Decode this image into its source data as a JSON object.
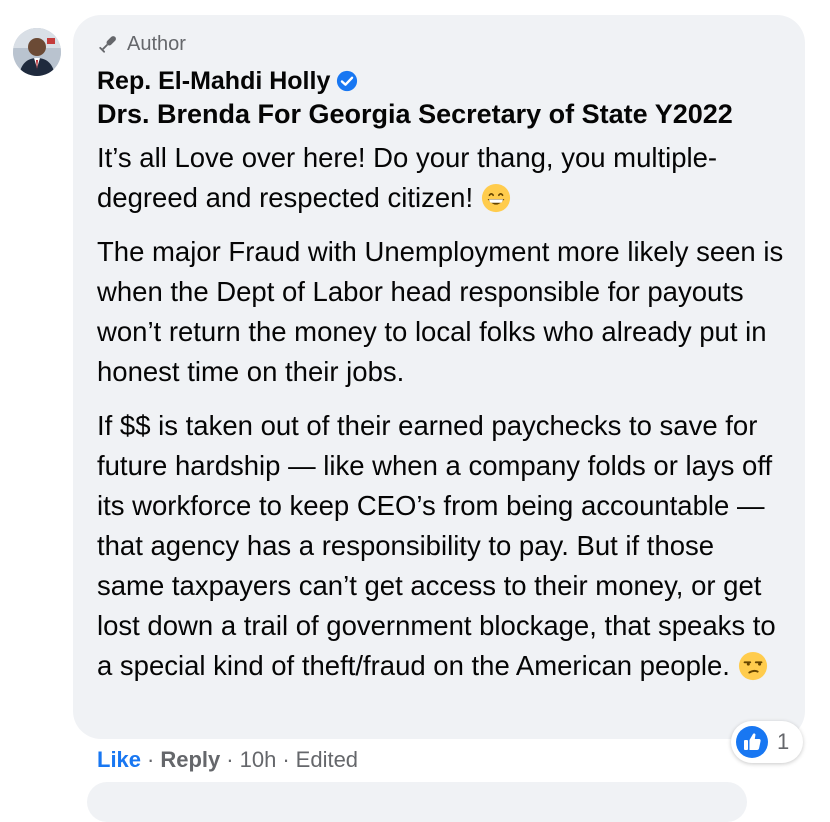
{
  "comment": {
    "author_badge": "Author",
    "author_name": "Rep. El-Mahdi Holly",
    "verified": true,
    "headline": "Drs. Brenda For Georgia Secretary of State Y2022",
    "paragraphs": [
      {
        "text": "It’s all Love over here! Do your thang, you multiple-degreed and respected citizen!",
        "emoji": "grinning-face-icon"
      },
      {
        "text": "The major Fraud with Unemployment more likely seen is when the Dept of Labor head responsible for payouts won’t return the money to local folks who already put in honest time on their jobs.",
        "emoji": ""
      },
      {
        "text": "If $$ is taken out of their earned paychecks to save for future hardship — like when a company folds or lays off its workforce to keep CEO’s from being accountable — that agency has a responsibility to pay. But if those same taxpayers can’t get access to their money, or get lost down a trail of government blockage, that speaks to a special kind of theft/fraud on the American people.",
        "emoji": "unamused-face-icon"
      }
    ]
  },
  "actions": {
    "like": "Like",
    "reply": "Reply",
    "time": "10h",
    "edited": "Edited",
    "separator": "·"
  },
  "reactions": {
    "count": "1",
    "icon": "thumbs-up-icon"
  },
  "colors": {
    "bubble": "#f0f2f5",
    "link": "#1877f2",
    "meta": "#65676b",
    "verified": "#1877f2"
  }
}
